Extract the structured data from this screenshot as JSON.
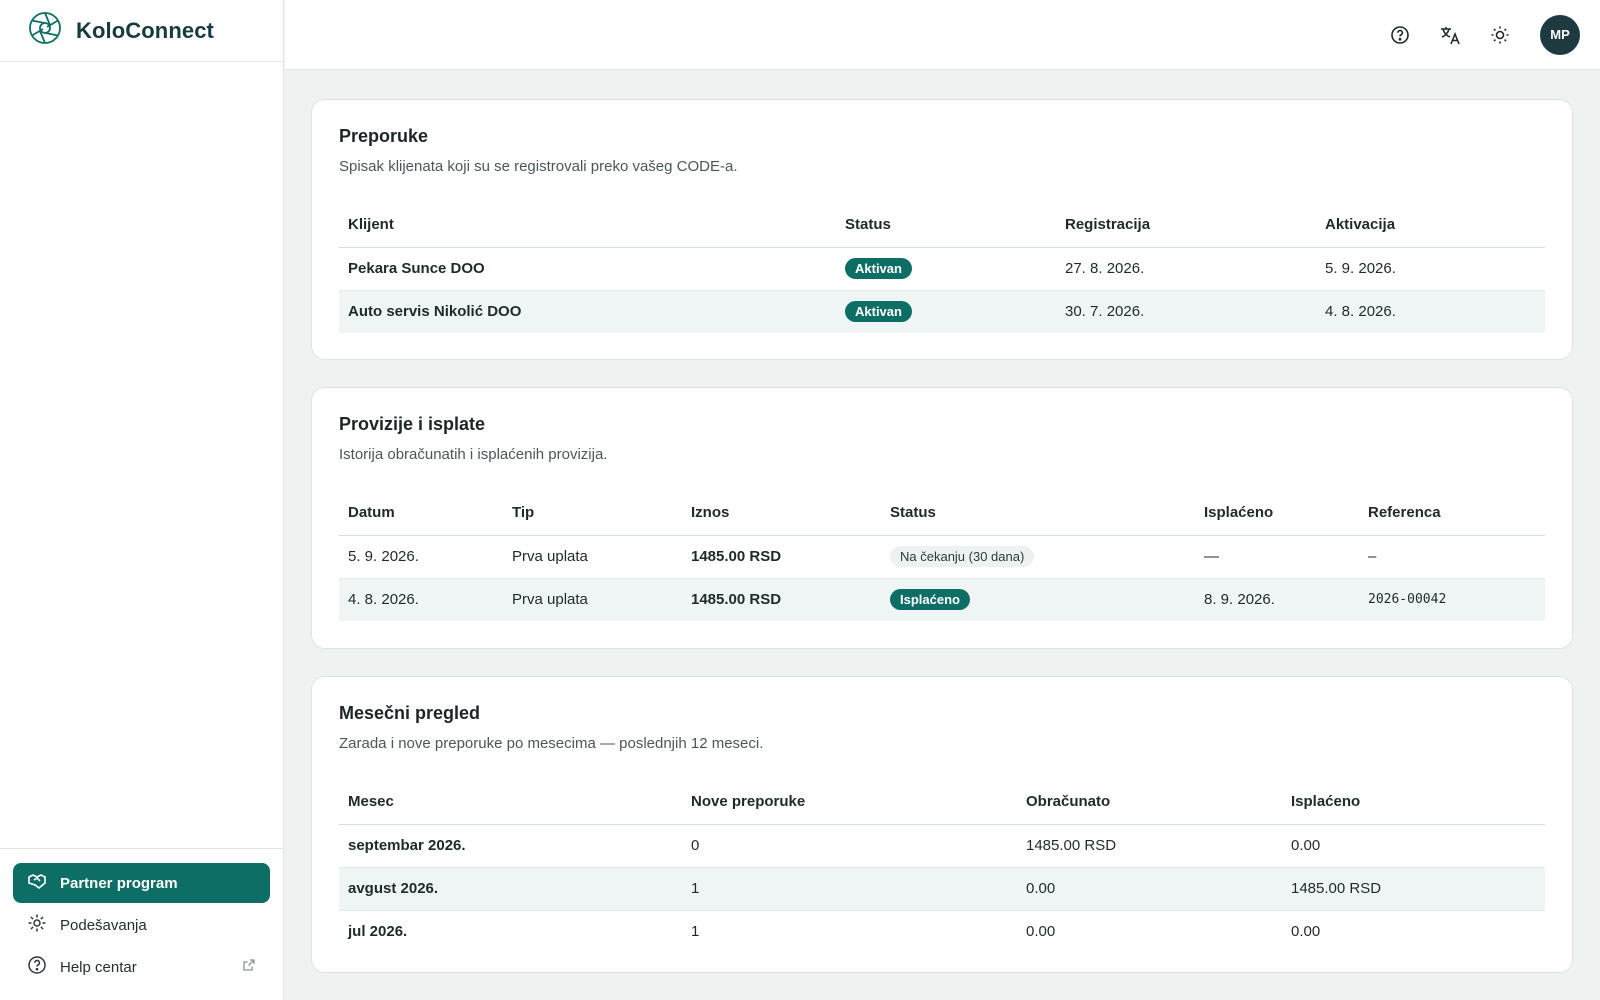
{
  "app": {
    "brand": "KoloConnect"
  },
  "sidebar": {
    "items": [
      {
        "label": "Partner program",
        "icon": "handshake-icon",
        "active": true
      },
      {
        "label": "Podešavanja",
        "icon": "gear-icon"
      },
      {
        "label": "Help centar",
        "icon": "help-circle-icon",
        "external": true
      }
    ]
  },
  "topbar": {
    "icons": [
      "help-icon",
      "translate-icon",
      "sun-icon"
    ],
    "avatar_initials": "MP"
  },
  "referrals": {
    "title": "Preporuke",
    "subtitle": "Spisak klijenata koji su se registrovali preko vašeg CODE-a.",
    "columns": [
      "Klijent",
      "Status",
      "Registracija",
      "Aktivacija"
    ],
    "rows": [
      {
        "client": "Pekara Sunce DOO",
        "status": "Aktivan",
        "registered": "27. 8. 2026.",
        "activated": "5. 9. 2026."
      },
      {
        "client": "Auto servis Nikolić DOO",
        "status": "Aktivan",
        "registered": "30. 7. 2026.",
        "activated": "4. 8. 2026."
      }
    ]
  },
  "commissions": {
    "title": "Provizije i isplate",
    "subtitle": "Istorija obračunatih i isplaćenih provizija.",
    "columns": [
      "Datum",
      "Tip",
      "Iznos",
      "Status",
      "Isplaćeno",
      "Referenca"
    ],
    "rows": [
      {
        "date": "5. 9. 2026.",
        "type": "Prva uplata",
        "amount": "1485.00 RSD",
        "status": "Na čekanju (30 dana)",
        "paid": "—",
        "reference": "–"
      },
      {
        "date": "4. 8. 2026.",
        "type": "Prva uplata",
        "amount": "1485.00 RSD",
        "status": "Isplaćeno",
        "paid": "8. 9. 2026.",
        "reference": "2026-00042"
      }
    ]
  },
  "monthly": {
    "title": "Mesečni pregled",
    "subtitle": "Zarada i nove preporuke po mesecima — poslednjih 12 meseci.",
    "columns": [
      "Mesec",
      "Nove preporuke",
      "Obračunato",
      "Isplaćeno"
    ],
    "rows": [
      {
        "month": "septembar 2026.",
        "new_referrals": "0",
        "accrued": "1485.00 RSD",
        "paid": "0.00"
      },
      {
        "month": "avgust 2026.",
        "new_referrals": "1",
        "accrued": "0.00",
        "paid": "1485.00 RSD"
      },
      {
        "month": "jul 2026.",
        "new_referrals": "1",
        "accrued": "0.00",
        "paid": "0.00"
      }
    ]
  },
  "colors": {
    "accent": "#0d6e66",
    "brand_text": "#173a3f",
    "background": "#eef3f2"
  }
}
